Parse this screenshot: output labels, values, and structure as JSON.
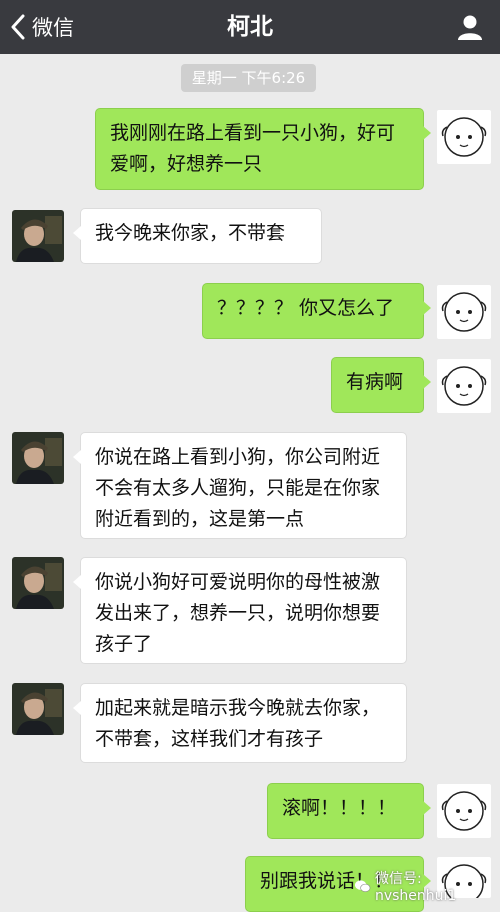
{
  "header": {
    "back_label": "微信",
    "title": "柯北",
    "back_icon": "chevron-left-icon",
    "profile_icon": "person-icon",
    "bg_color": "#393a3f"
  },
  "timestamp": "星期一 下午6:26",
  "messages": [
    {
      "side": "right",
      "text": "我刚刚在路上看到一只小狗，好可爱啊，好想养一只"
    },
    {
      "side": "left",
      "text": "我今晚来你家，不带套"
    },
    {
      "side": "right",
      "text": "？？？？ 你又怎么了"
    },
    {
      "side": "right",
      "text": "有病啊"
    },
    {
      "side": "left",
      "text": "你说在路上看到小狗，你公司附近不会有太多人遛狗，只能是在你家附近看到的，这是第一点"
    },
    {
      "side": "left",
      "text": "你说小狗好可爱说明你的母性被激发出来了，想养一只，说明你想要孩子了"
    },
    {
      "side": "left",
      "text": "加起来就是暗示我今晚就去你家，不带套，这样我们才有孩子"
    },
    {
      "side": "right",
      "text": "滚啊！！！！"
    },
    {
      "side": "right",
      "text": "别跟我说话！！"
    }
  ],
  "watermark": "微信号: nvshenhui1",
  "colors": {
    "chat_bg": "#ebebeb",
    "bubble_sent": "#a0e75a",
    "bubble_received": "#ffffff"
  }
}
